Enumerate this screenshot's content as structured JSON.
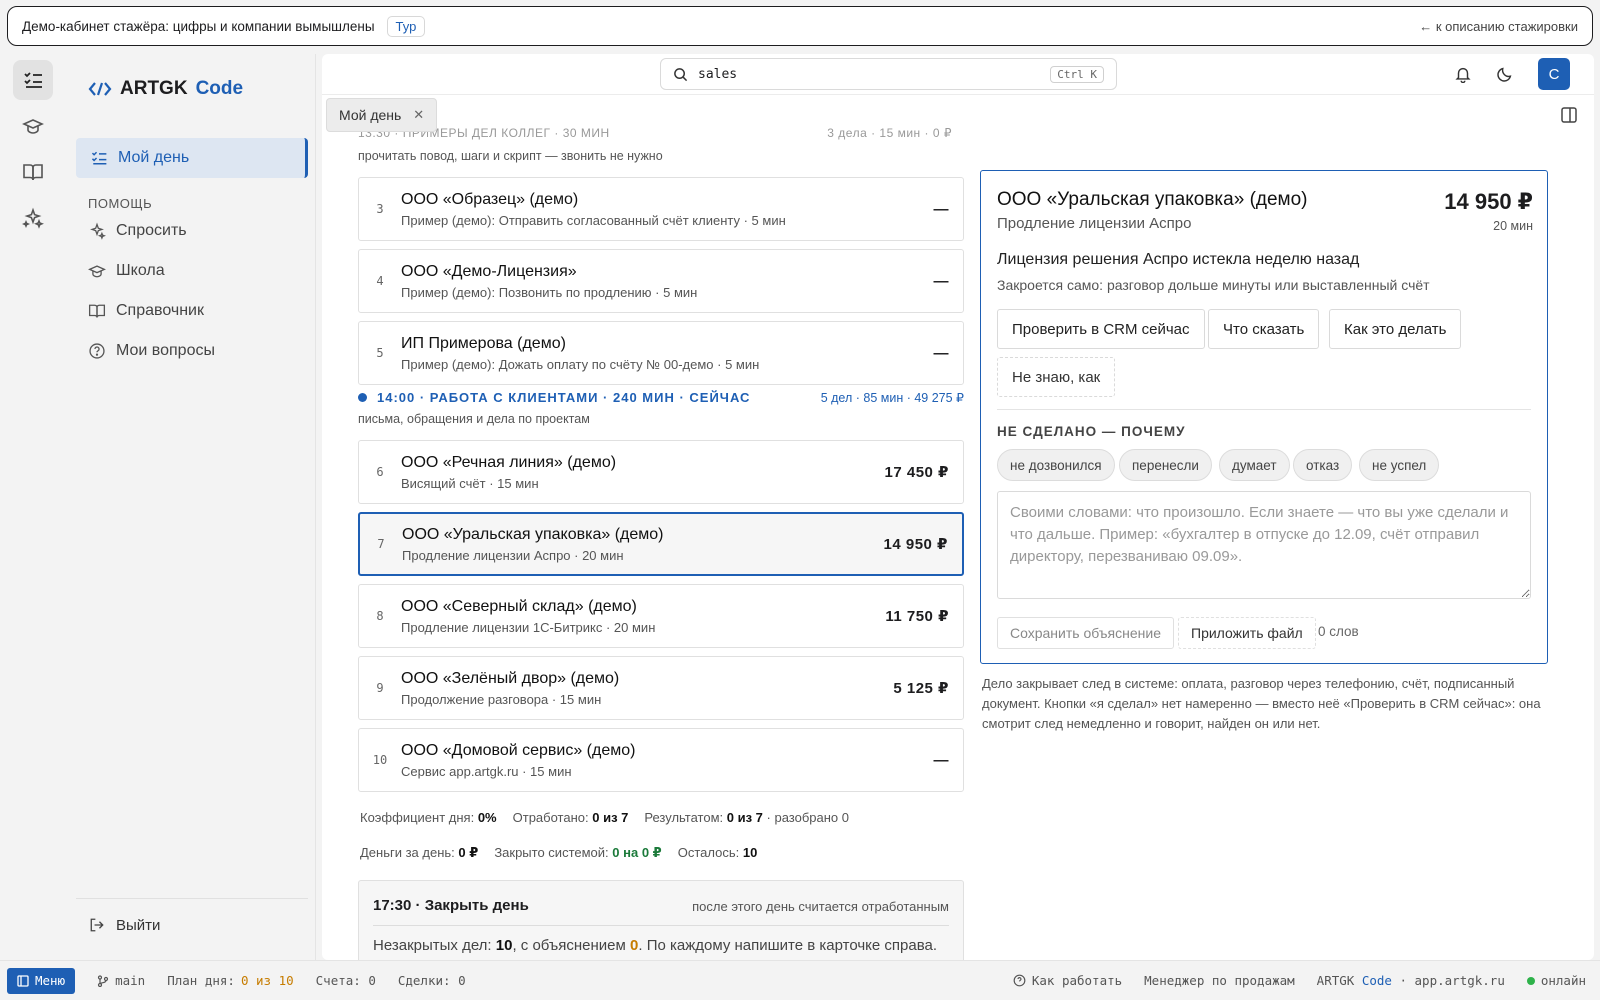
{
  "banner": {
    "text": "Демо-кабинет стажёра: цифры и компании вымышлены",
    "tour": "Тур",
    "back": "← к описанию стажировки"
  },
  "sidebar": {
    "brand_a": "ARTGK",
    "brand_b": "Code",
    "active_item": "Мой день",
    "section": "ПОМОЩЬ",
    "items": [
      "Спросить",
      "Школа",
      "Справочник",
      "Мои вопросы"
    ],
    "logout": "Выйти"
  },
  "topbar": {
    "search_value": "sales",
    "shortcut": "Ctrl K",
    "avatar": "С",
    "tab": "Мой день"
  },
  "list": {
    "faded_header": "13:30 · ПРИМЕРЫ ДЕЛ КОЛЛЕГ · 30 МИН",
    "faded_header_right": "3 дела · 15 мин · 0 ₽",
    "faded_sub": "прочитать повод, шаги и скрипт — звонить не нужно",
    "cards": [
      {
        "num": "3",
        "name": "ООО «Образец» (демо)",
        "desc": "Пример (демо): Отправить согласованный счёт клиенту · 5 мин",
        "amount": "—"
      },
      {
        "num": "4",
        "name": "ООО «Демо-Лицензия»",
        "desc": "Пример (демо): Позвонить по продлению · 5 мин",
        "amount": "—"
      },
      {
        "num": "5",
        "name": "ИП Примерова (демо)",
        "desc": "Пример (демо): Дожать оплату по счёту № 00-демо · 5 мин",
        "amount": "—"
      },
      {
        "num": "6",
        "name": "ООО «Речная линия» (демо)",
        "desc": "Висящий счёт · 15 мин",
        "amount": "17 450 ₽"
      },
      {
        "num": "7",
        "name": "ООО «Уральская упаковка» (демо)",
        "desc": "Продление лицензии Аспро · 20 мин",
        "amount": "14 950 ₽"
      },
      {
        "num": "8",
        "name": "ООО «Северный склад» (демо)",
        "desc": "Продление лицензии 1С-Битрикс · 20 мин",
        "amount": "11 750 ₽"
      },
      {
        "num": "9",
        "name": "ООО «Зелёный двор» (демо)",
        "desc": "Продолжение разговора · 15 мин",
        "amount": "5 125 ₽"
      },
      {
        "num": "10",
        "name": "ООО «Домовой сервис» (демо)",
        "desc": "Сервис app.artgk.ru · 15 мин",
        "amount": "—"
      }
    ],
    "group": {
      "title": "14:00 · РАБОТА С КЛИЕНТАМИ · 240 МИН · СЕЙЧАС",
      "right": "5 дел · 85 мин · 49 275 ₽",
      "sub": "письма, обращения и дела по проектам"
    },
    "stats1": {
      "coef_label": "Коэффициент дня:",
      "coef": "0%",
      "done_label": "Отработано:",
      "done": "0 из 7",
      "result_label": "Результатом:",
      "result": "0 из 7",
      "result_tail": "· разобрано 0"
    },
    "stats2": {
      "money_label": "Деньги за день:",
      "money": "0 ₽",
      "closed_label": "Закрыто системой:",
      "closed": "0 на 0 ₽",
      "left_label": "Осталось:",
      "left": "10"
    },
    "close_day": {
      "title": "17:30 · Закрыть день",
      "right": "после этого день считается отработанным",
      "body_a": "Незакрытых дел:",
      "open_count": "10",
      "body_b": ", с объяснением",
      "explained": "0",
      "body_c": ". По каждому напишите в карточке справа."
    }
  },
  "detail": {
    "title": "ООО «Уральская упаковка» (демо)",
    "subtitle": "Продление лицензии Аспро",
    "amount": "14 950 ₽",
    "minutes": "20 мин",
    "reason": "Лицензия решения Аспро истекла неделю назад",
    "auto_close": "Закроется само: разговор дольше минуты или выставленный счёт",
    "btn_check": "Проверить в CRM сейчас",
    "btn_say": "Что сказать",
    "btn_how": "Как это делать",
    "btn_dontknow": "Не знаю, как",
    "not_done_label": "НЕ СДЕЛАНО — ПОЧЕМУ",
    "chips": [
      "не дозвонился",
      "перенесли",
      "думает",
      "отказ",
      "не успел"
    ],
    "textarea_placeholder": "Своими словами: что произошло. Если знаете — что вы уже сделали и что дальше. Пример: «бухгалтер в отпуске до 12.09, счёт отправил директору, перезваниваю 09.09».",
    "btn_save": "Сохранить объяснение",
    "btn_attach": "Приложить файл",
    "words": "0 слов",
    "note": "Дело закрывает след в системе: оплата, разговор через телефонию, счёт, подписанный документ. Кнопки «я сделал» нет намеренно — вместо неё «Проверить в CRM сейчас»: она смотрит след немедленно и говорит, найден он или нет."
  },
  "statusbar": {
    "menu": "Меню",
    "branch": "main",
    "plan_label": "План дня:",
    "plan_value": "0 из 10",
    "bills": "Счета: 0",
    "deals": "Сделки: 0",
    "how": "Как работать",
    "role": "Менеджер по продажам",
    "brand_a": "ARTGK",
    "brand_b": "Code",
    "domain": "· app.artgk.ru",
    "online": "онлайн"
  },
  "colors": {
    "accent": "#1e5fb4",
    "orange": "#c67c00",
    "green": "#1b7a3a",
    "online": "#2eb24a"
  }
}
